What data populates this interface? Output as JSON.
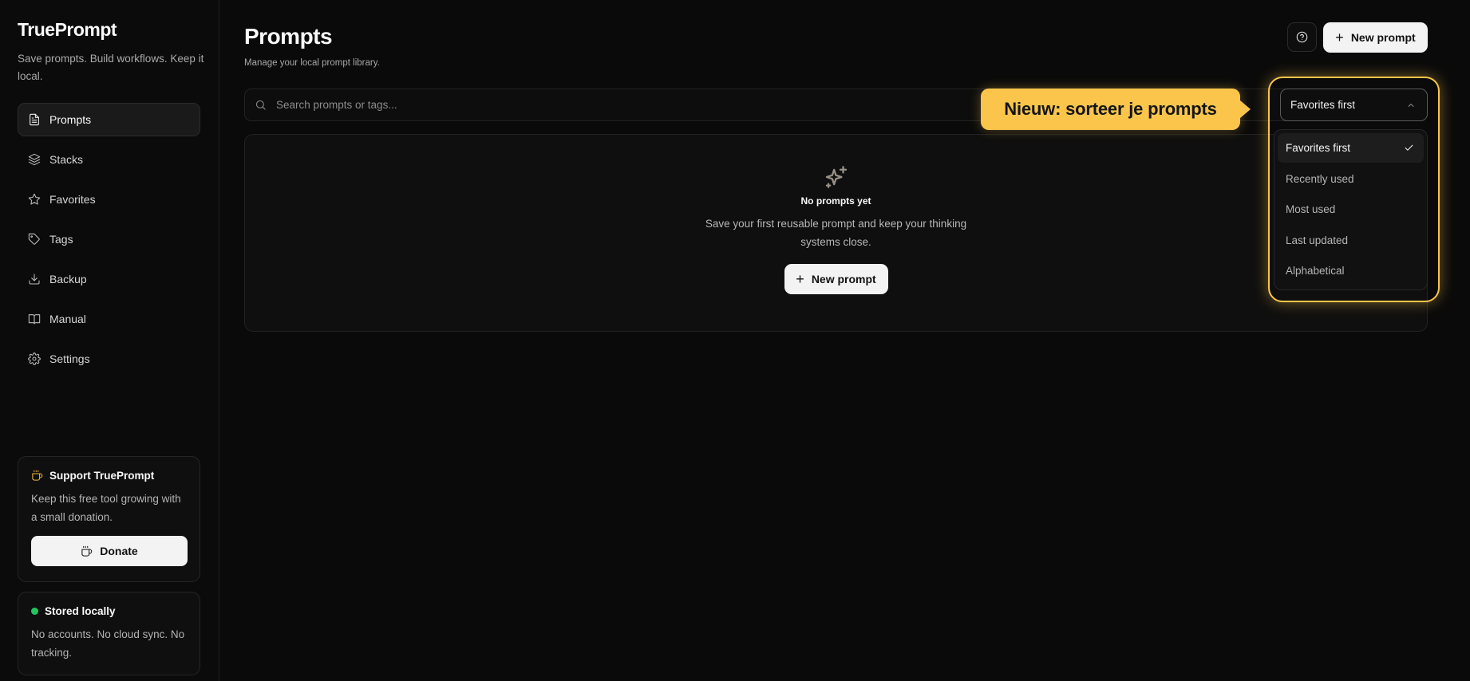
{
  "brand": {
    "name": "TruePrompt",
    "tagline": "Save prompts. Build workflows. Keep it local."
  },
  "sidebar": {
    "items": [
      {
        "label": "Prompts",
        "icon": "file-text-icon",
        "active": true
      },
      {
        "label": "Stacks",
        "icon": "layers-icon"
      },
      {
        "label": "Favorites",
        "icon": "star-icon"
      },
      {
        "label": "Tags",
        "icon": "tag-icon"
      },
      {
        "label": "Backup",
        "icon": "download-icon"
      },
      {
        "label": "Manual",
        "icon": "book-icon"
      },
      {
        "label": "Settings",
        "icon": "gear-icon"
      }
    ]
  },
  "support": {
    "title": "Support TruePrompt",
    "text": "Keep this free tool growing with a small donation.",
    "donate_label": "Donate",
    "icon": "coffee-icon"
  },
  "stored": {
    "title": "Stored locally",
    "text": "No accounts. No cloud sync. No tracking.",
    "status_color": "#22c55e"
  },
  "header": {
    "title": "Prompts",
    "subtitle": "Manage your local prompt library.",
    "new_prompt_label": "New prompt"
  },
  "search": {
    "placeholder": "Search prompts or tags..."
  },
  "empty_state": {
    "title": "No prompts yet",
    "text": "Save your first reusable prompt and keep your thinking systems close.",
    "button_label": "New prompt"
  },
  "callout": {
    "text": "Nieuw: sorteer je prompts",
    "color": "#fbc54c"
  },
  "sort": {
    "selected": "Favorites first",
    "options": [
      "Favorites first",
      "Recently used",
      "Most used",
      "Last updated",
      "Alphabetical"
    ]
  },
  "colors": {
    "accent": "#fbc54c",
    "background": "#0a0a0a",
    "button_bg": "#f3f3f3"
  }
}
